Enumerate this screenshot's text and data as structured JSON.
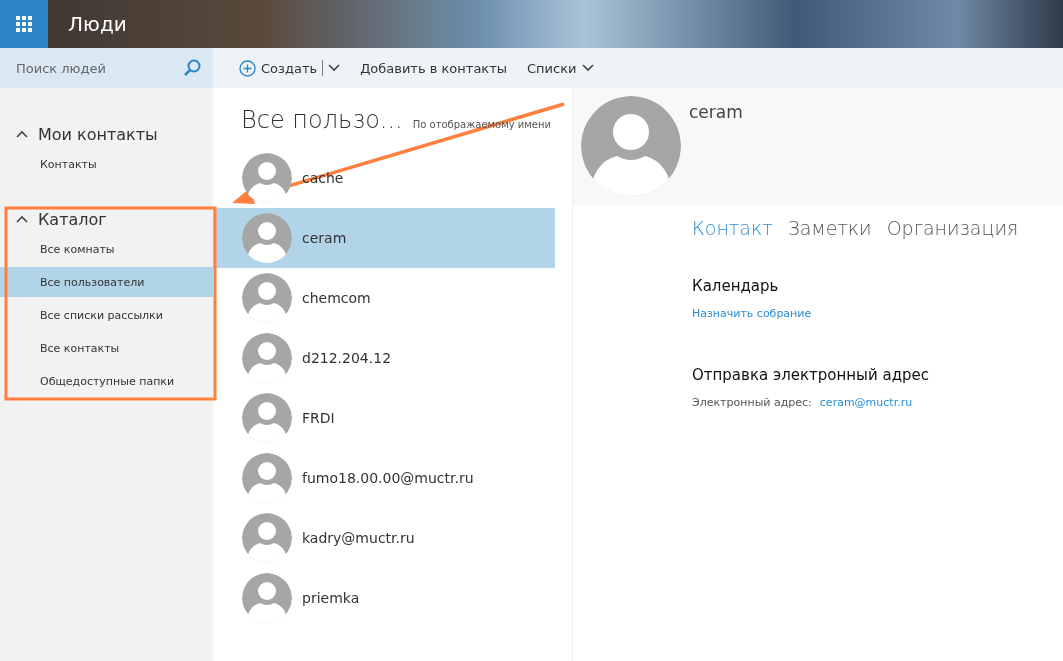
{
  "app": {
    "title": "Люди"
  },
  "search": {
    "placeholder": "Поиск людей"
  },
  "toolbar": [
    {
      "kind": "create",
      "label": "Создать"
    },
    {
      "kind": "plain",
      "label": "Добавить в контакты"
    },
    {
      "kind": "dropdown",
      "label": "Списки"
    }
  ],
  "sidebar": {
    "sections": [
      {
        "title": "Мои контакты",
        "expanded": true,
        "items": [
          {
            "label": "Контакты",
            "selected": false
          }
        ]
      },
      {
        "title": "Каталог",
        "expanded": true,
        "items": [
          {
            "label": "Все комнаты",
            "selected": false
          },
          {
            "label": "Все пользователи",
            "selected": true
          },
          {
            "label": "Все списки рассылки",
            "selected": false
          },
          {
            "label": "Все контакты",
            "selected": false
          },
          {
            "label": "Общедоступные папки",
            "selected": false
          }
        ]
      }
    ]
  },
  "list": {
    "title": "Все пользо...",
    "sort": "По отображаемому имени",
    "rows": [
      {
        "name": "cache",
        "selected": false
      },
      {
        "name": "ceram",
        "selected": true
      },
      {
        "name": "chemcom",
        "selected": false
      },
      {
        "name": "d212.204.12",
        "selected": false
      },
      {
        "name": "FRDI",
        "selected": false
      },
      {
        "name": "fumo18.00.00@muctr.ru",
        "selected": false
      },
      {
        "name": "kadry@muctr.ru",
        "selected": false
      },
      {
        "name": "priemka",
        "selected": false
      }
    ]
  },
  "detail": {
    "name": "ceram",
    "tabs": [
      {
        "label": "Контакт",
        "selected": true
      },
      {
        "label": "Заметки",
        "selected": false
      },
      {
        "label": "Организация",
        "selected": false
      }
    ],
    "calendar": {
      "heading": "Календарь",
      "link": "Назначить собрание"
    },
    "email": {
      "heading": "Отправка электронный адрес",
      "label": "Электронный адрес:",
      "value": "ceram@muctr.ru"
    }
  }
}
